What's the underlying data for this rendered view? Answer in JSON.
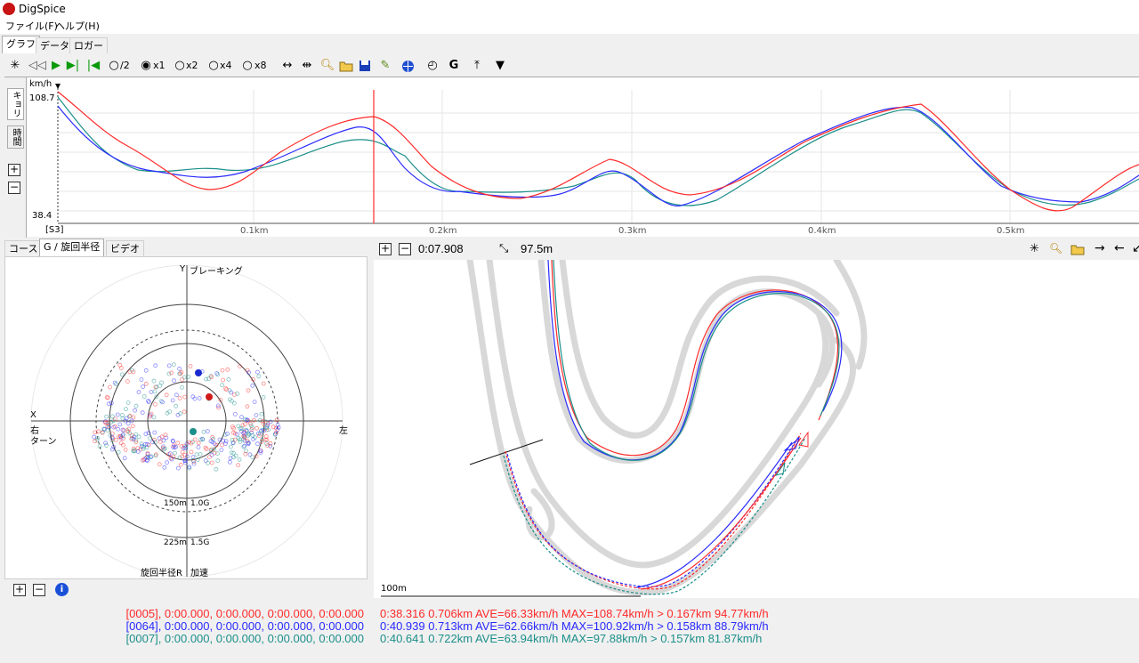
{
  "window": {
    "title": "DigSpice"
  },
  "menu": {
    "items": [
      "ファイル(F)",
      "ヘルプ(H)"
    ]
  },
  "main_tabs": [
    "グラフ",
    "データ",
    "ロガー"
  ],
  "toolbar": {
    "speeds": [
      "/2",
      "x1",
      "x2",
      "x4",
      "x8"
    ],
    "selected_speed": "x1"
  },
  "graph": {
    "side_tabs": [
      "キョリ",
      "時間"
    ],
    "y_unit": "km/h",
    "y_max_label": "108.7",
    "y_min_label": "38.4",
    "sector_label": "[S3]",
    "x_ticks": [
      "0.1km",
      "0.2km",
      "0.3km",
      "0.4km",
      "0.5km"
    ]
  },
  "left_tabs": [
    "コース",
    "G / 旋回半径",
    "ビデオ"
  ],
  "gcircle": {
    "label_top_axis": "Y",
    "label_top": "ブレーキング",
    "label_left_axis": "X",
    "label_left": "右",
    "label_left2": "ターン",
    "label_right": "左",
    "ring1_radius": "150m",
    "ring1_g": "1.0G",
    "ring2_radius": "225m",
    "ring2_g": "1.5G",
    "label_bottom_left": "旋回半径R",
    "label_bottom_right": "加速"
  },
  "map": {
    "time": "0:07.908",
    "distance": "97.5m",
    "scale_label": "100m"
  },
  "laps_left": [
    {
      "text": "[0005], 0:00.000, 0:00.000, 0:00.000, 0:00.000",
      "color": "#ff2a2a"
    },
    {
      "text": "[0064], 0:00.000, 0:00.000, 0:00.000, 0:00.000",
      "color": "#2a2aff"
    },
    {
      "text": "[0007], 0:00.000, 0:00.000, 0:00.000, 0:00.000",
      "color": "#1b8f8a"
    }
  ],
  "laps_right": [
    {
      "text": "0:38.316 0.706km AVE=66.33km/h MAX=108.74km/h > 0.167km 94.77km/h",
      "color": "#ff2a2a"
    },
    {
      "text": "0:40.939 0.713km AVE=62.66km/h MAX=100.92km/h > 0.158km 88.79km/h",
      "color": "#2a2aff"
    },
    {
      "text": "0:40.641 0.722km AVE=63.94km/h MAX=97.88km/h > 0.157km 81.87km/h",
      "color": "#1b8f8a"
    }
  ],
  "colors": {
    "red": "#ff2a2a",
    "blue": "#2a2aff",
    "teal": "#1b8f8a"
  }
}
